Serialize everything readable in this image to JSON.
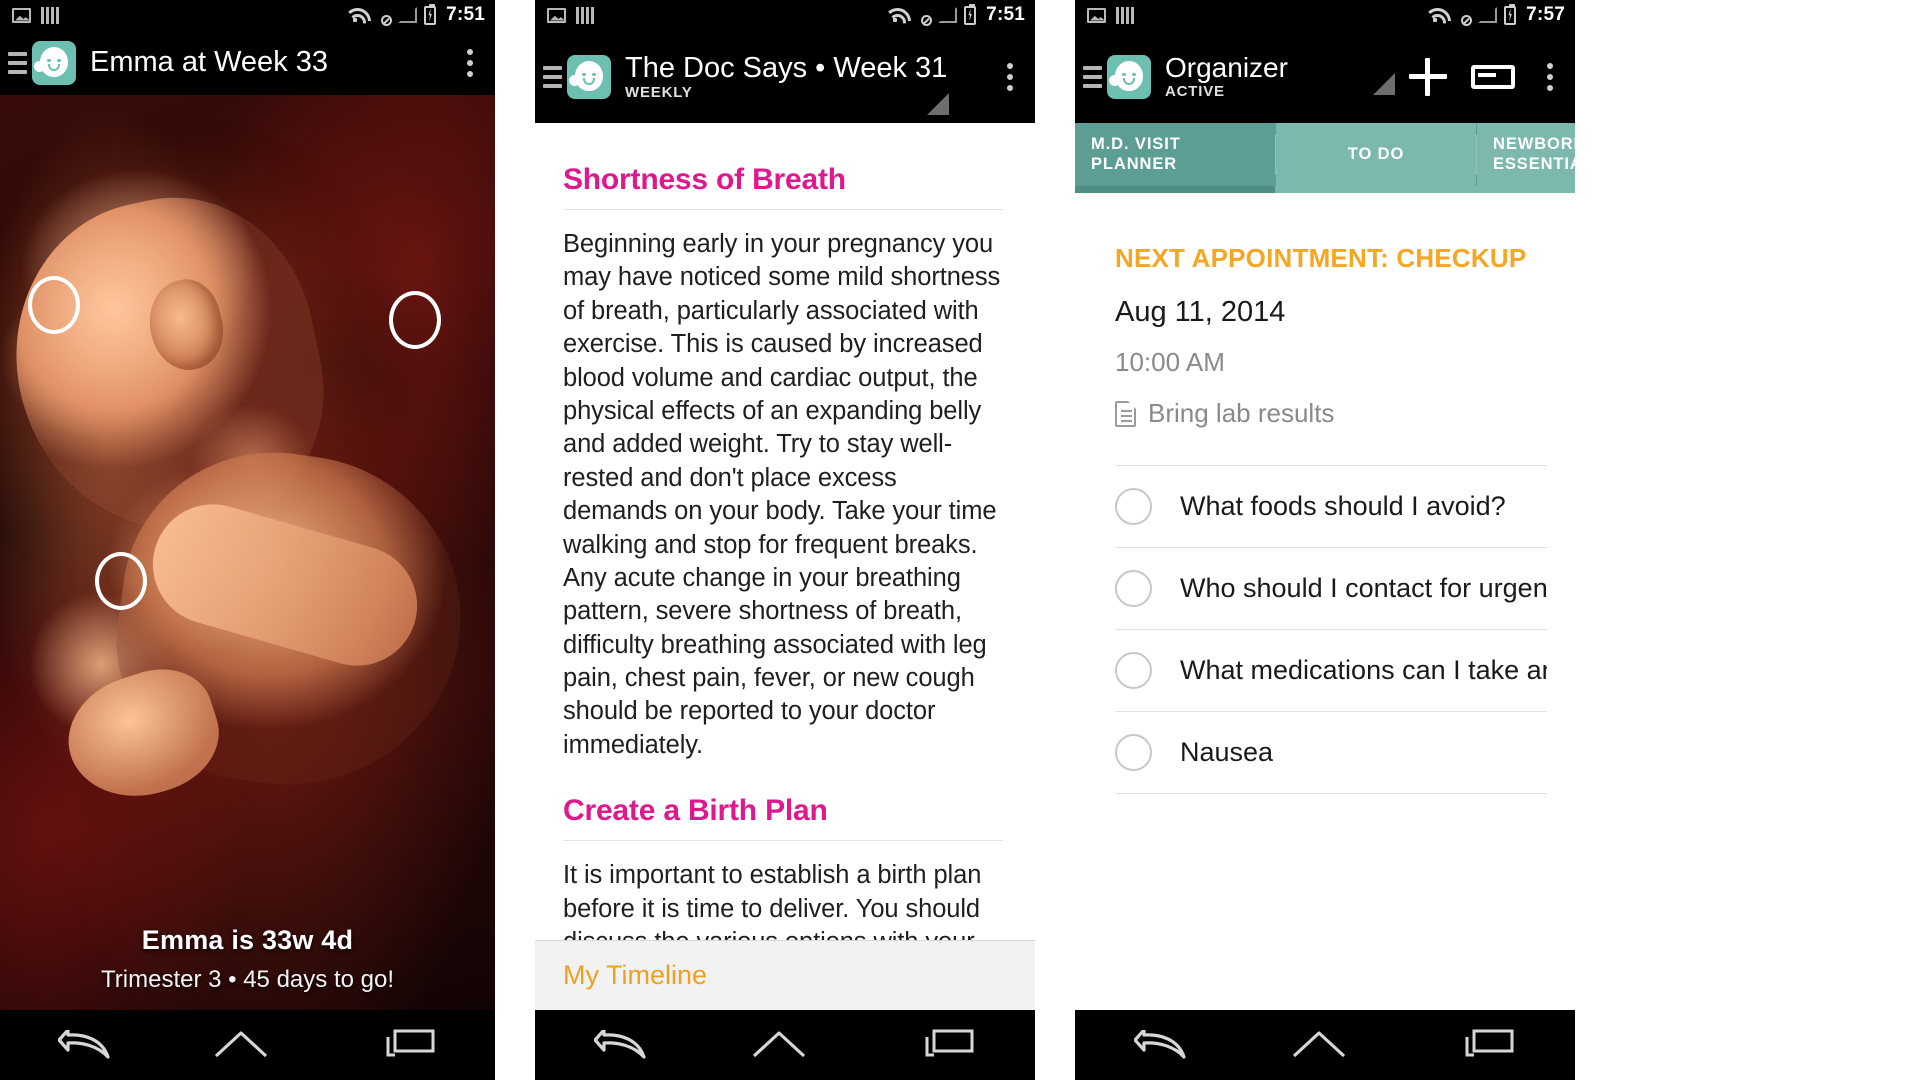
{
  "app": {
    "icon_name": "baby-face-icon",
    "accent_teal": "#6dbfb2",
    "accent_magenta": "#e0188f",
    "accent_orange": "#f5a623",
    "tab_teal_active": "#5d9e94",
    "tab_teal_inactive": "#7cb8ae"
  },
  "screen1": {
    "statusbar": {
      "time": "7:51",
      "icons": [
        "photo-icon",
        "bars-icon",
        "wifi-icon",
        "sim-disabled-icon",
        "signal-icon",
        "battery-charging-icon"
      ]
    },
    "actionbar": {
      "drawer_label": "drawer-icon",
      "title": "Emma at Week 33",
      "overflow_label": "overflow-menu-icon"
    },
    "hero": {
      "caption_main": "Emma is 33w 4d",
      "caption_sub": "Trimester 3 • 45 days to go!",
      "hotspots": [
        "hotspot-1",
        "hotspot-2",
        "hotspot-3"
      ]
    }
  },
  "screen2": {
    "statusbar": {
      "time": "7:51"
    },
    "actionbar": {
      "title": "The Doc Says • Week 31",
      "subtitle": "WEEKLY"
    },
    "sections": [
      {
        "heading": "Shortness of Breath",
        "body": "Beginning early in your pregnancy you may have noticed some mild shortness of breath, particularly associated with exercise. This is caused by increased blood volume and cardiac output, the physical effects of an expanding belly and added weight. Try to stay well-rested and don't place excess demands on your body. Take your time walking and stop for frequent breaks. Any acute change in your breathing pattern, severe shortness of breath, difficulty breathing associated with leg pain, chest pain, fever, or new cough should be reported to your doctor immediately."
      },
      {
        "heading": "Create a Birth Plan",
        "body": "It is important to establish a birth plan before it is time to deliver. You should discuss the various options with your doctor and talk with your partner to decide on a"
      }
    ],
    "footer": {
      "link_label": "My Timeline"
    }
  },
  "screen3": {
    "statusbar": {
      "time": "7:57"
    },
    "actionbar": {
      "title": "Organizer",
      "subtitle": "ACTIVE",
      "add_label": "add-icon",
      "card_label": "card-icon",
      "overflow_label": "overflow-menu-icon"
    },
    "tabs": [
      {
        "label": "M.D. VISIT\nPLANNER",
        "active": true
      },
      {
        "label": "TO DO",
        "active": false
      },
      {
        "label": "NEWBORN\nESSENTIA",
        "active": false
      }
    ],
    "appointment": {
      "title": "NEXT APPOINTMENT: CHECKUP",
      "date": "Aug 11, 2014",
      "time": "10:00 AM",
      "note": "Bring lab results",
      "note_icon": "document-icon"
    },
    "questions": [
      "What foods should I avoid?",
      "Who should I contact for urgent matters?",
      "What medications can I take and which o...",
      "Nausea"
    ]
  },
  "navbar": {
    "back_label": "back-icon",
    "home_label": "home-icon",
    "recents_label": "recents-icon"
  }
}
